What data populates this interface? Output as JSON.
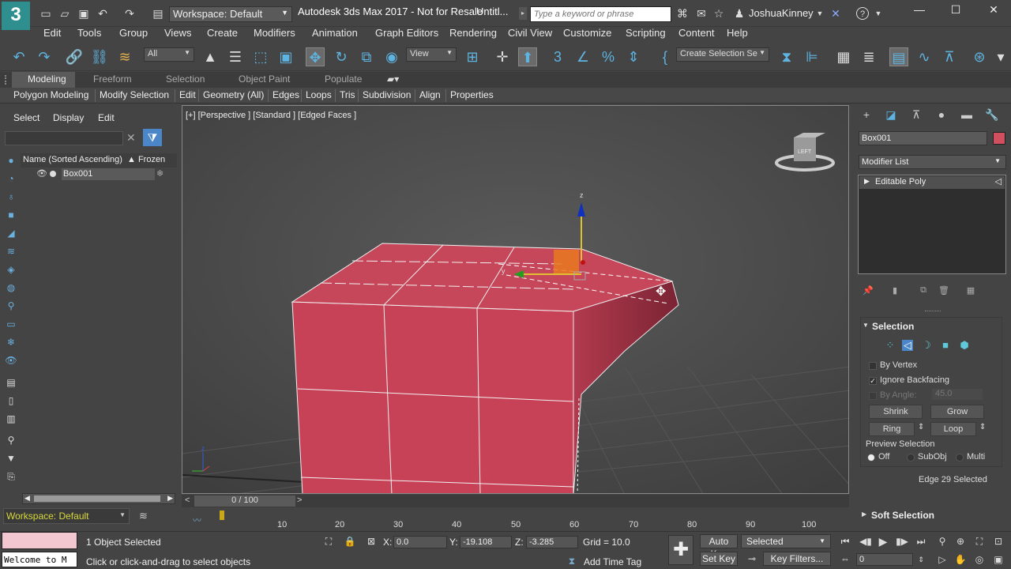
{
  "titlebar": {
    "logo": "3",
    "workspace": "Workspace: Default",
    "app_title": "Autodesk 3ds Max 2017 - Not for Resale",
    "doc_title": "Untitl...",
    "search_placeholder": "Type a keyword or phrase",
    "username": "JoshuaKinney"
  },
  "menus": [
    "Edit",
    "Tools",
    "Group",
    "Views",
    "Create",
    "Modifiers",
    "Animation",
    "Graph Editors",
    "Rendering",
    "Civil View",
    "Customize",
    "Scripting",
    "Content",
    "Help"
  ],
  "toolbar": {
    "filter_value": "All",
    "refcoord_value": "View",
    "selection_set_value": "Create Selection Se"
  },
  "ribbon": {
    "tabs": [
      "Modeling",
      "Freeform",
      "Selection",
      "Object Paint",
      "Populate"
    ],
    "panels": [
      "Polygon Modeling",
      "Modify Selection",
      "Edit",
      "Geometry (All)",
      "Edges",
      "Loops",
      "Tris",
      "Subdivision",
      "Align",
      "Properties"
    ]
  },
  "scene_explorer": {
    "menus": [
      "Select",
      "Display",
      "Edit"
    ],
    "col_name": "Name (Sorted Ascending)",
    "col_frozen": "▲ Frozen",
    "objects": [
      "Box001"
    ],
    "workspace": "Workspace: Default"
  },
  "viewport": {
    "label": "[+] [Perspective ] [Standard ] [Edged Faces ]"
  },
  "timeline": {
    "slider_label": "0 / 100",
    "ticks": [
      "10",
      "20",
      "30",
      "40",
      "50",
      "60",
      "70",
      "80",
      "90",
      "100"
    ]
  },
  "command_panel": {
    "object_name": "Box001",
    "object_color": "#d0505f",
    "modifier_list": "Modifier List",
    "stack_items": [
      "Editable Poly"
    ],
    "selection_title": "Selection",
    "by_vertex": "By Vertex",
    "ignore_backfacing": "Ignore Backfacing",
    "by_angle": "By Angle:",
    "by_angle_value": "45.0",
    "shrink": "Shrink",
    "grow": "Grow",
    "ring": "Ring",
    "loop": "Loop",
    "preview_selection": "Preview Selection",
    "preview_off": "Off",
    "preview_subobj": "SubObj",
    "preview_multi": "Multi",
    "status": "Edge 29 Selected",
    "soft_selection": "Soft Selection"
  },
  "statusbar": {
    "listener_text": "Welcome to M",
    "objects_selected": "1 Object Selected",
    "prompt": "Click or click-and-drag to select objects",
    "x_label": "X:",
    "x_value": "0.0",
    "y_label": "Y:",
    "y_value": "-19.108",
    "z_label": "Z:",
    "z_value": "-3.285",
    "grid": "Grid = 10.0",
    "add_time_tag": "Add Time Tag",
    "auto_key": "Auto Key",
    "selected": "Selected",
    "set_key": "Set Key",
    "key_filters": "Key Filters...",
    "frame_value": "0"
  }
}
